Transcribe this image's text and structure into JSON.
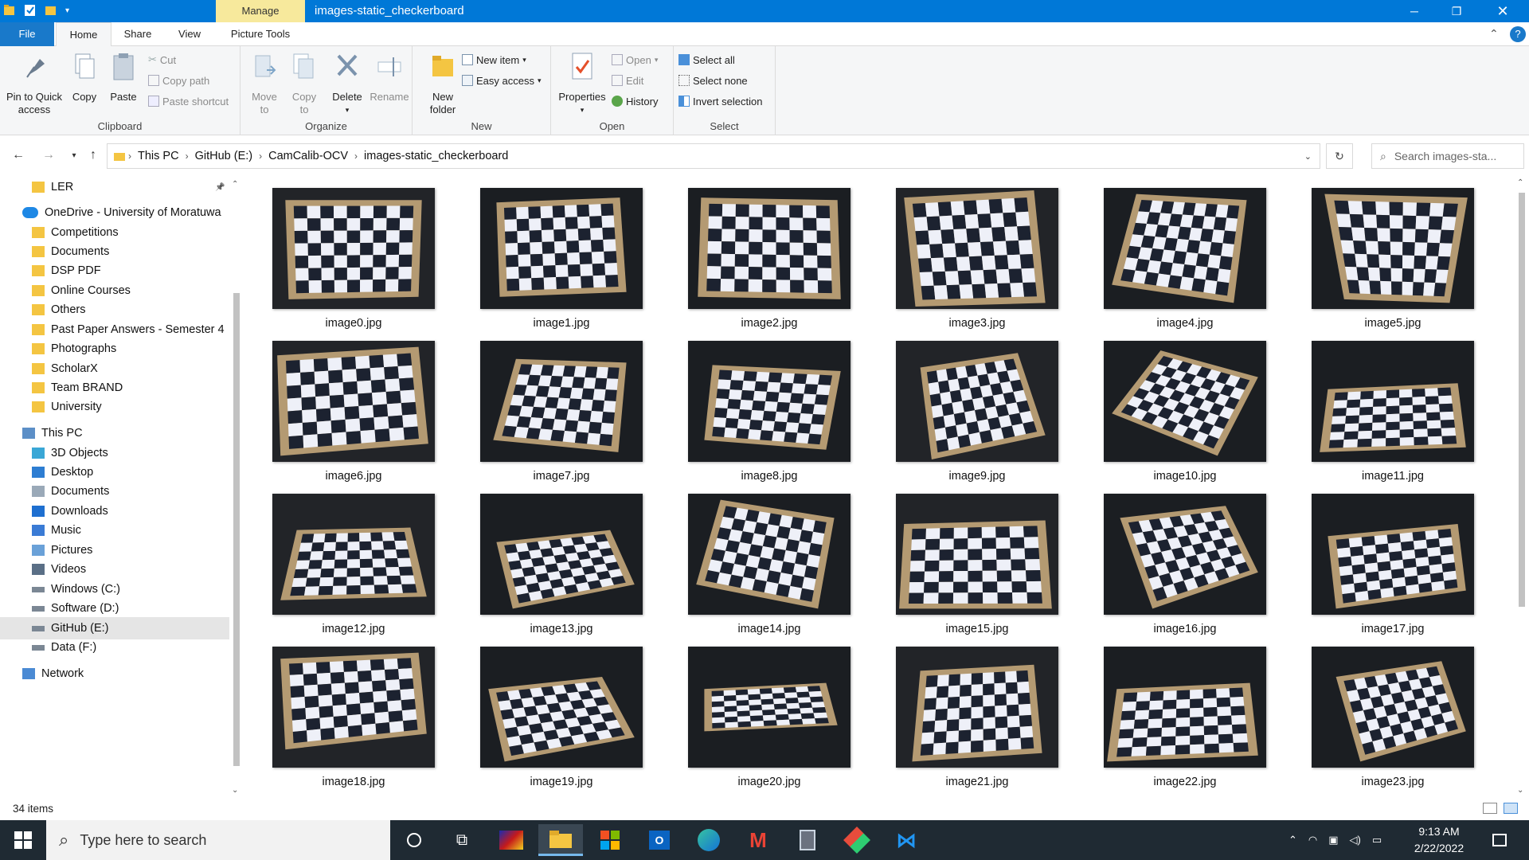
{
  "window": {
    "title": "images-static_checkerboard",
    "context_tab": "Manage"
  },
  "ribbon_tabs": [
    "File",
    "Home",
    "Share",
    "View",
    "Picture Tools"
  ],
  "ribbon": {
    "clipboard": {
      "label": "Clipboard",
      "pin": "Pin to Quick access",
      "copy": "Copy",
      "paste": "Paste",
      "cut": "Cut",
      "copy_path": "Copy path",
      "paste_shortcut": "Paste shortcut"
    },
    "organize": {
      "label": "Organize",
      "move_to": "Move to",
      "copy_to": "Copy to",
      "delete": "Delete",
      "rename": "Rename"
    },
    "new": {
      "label": "New",
      "new_folder": "New folder",
      "new_item": "New item",
      "easy_access": "Easy access"
    },
    "open": {
      "label": "Open",
      "properties": "Properties",
      "open": "Open",
      "edit": "Edit",
      "history": "History"
    },
    "select": {
      "label": "Select",
      "select_all": "Select all",
      "select_none": "Select none",
      "invert": "Invert selection"
    }
  },
  "address": {
    "crumbs": [
      "This PC",
      "GitHub (E:)",
      "CamCalib-OCV",
      "images-static_checkerboard"
    ],
    "search_placeholder": "Search images-sta..."
  },
  "nav": {
    "items": [
      {
        "label": "LER",
        "icon": "folder-icon"
      },
      {
        "label": "OneDrive - University of Moratuwa",
        "icon": "cloud-icon"
      },
      {
        "label": "Competitions",
        "icon": "folder-icon"
      },
      {
        "label": "Documents",
        "icon": "folder-icon"
      },
      {
        "label": "DSP PDF",
        "icon": "folder-icon"
      },
      {
        "label": "Online Courses",
        "icon": "folder-icon"
      },
      {
        "label": "Others",
        "icon": "folder-icon"
      },
      {
        "label": "Past Paper Answers -  Semester 4",
        "icon": "folder-icon"
      },
      {
        "label": "Photographs",
        "icon": "folder-icon"
      },
      {
        "label": "ScholarX",
        "icon": "folder-icon"
      },
      {
        "label": "Team BRAND",
        "icon": "folder-icon"
      },
      {
        "label": "University",
        "icon": "folder-icon"
      },
      {
        "label": "This PC",
        "icon": "computer-icon"
      },
      {
        "label": "3D Objects",
        "icon": "cube-icon"
      },
      {
        "label": "Desktop",
        "icon": "desktop-icon"
      },
      {
        "label": "Documents",
        "icon": "document-icon"
      },
      {
        "label": "Downloads",
        "icon": "download-icon"
      },
      {
        "label": "Music",
        "icon": "music-icon"
      },
      {
        "label": "Pictures",
        "icon": "picture-icon"
      },
      {
        "label": "Videos",
        "icon": "video-icon"
      },
      {
        "label": "Windows (C:)",
        "icon": "drive-icon"
      },
      {
        "label": "Software (D:)",
        "icon": "drive-icon"
      },
      {
        "label": "GitHub (E:)",
        "icon": "drive-icon"
      },
      {
        "label": "Data (F:)",
        "icon": "drive-icon"
      },
      {
        "label": "Network",
        "icon": "network-icon"
      }
    ]
  },
  "files": [
    "image0.jpg",
    "image1.jpg",
    "image2.jpg",
    "image3.jpg",
    "image4.jpg",
    "image5.jpg",
    "image6.jpg",
    "image7.jpg",
    "image8.jpg",
    "image9.jpg",
    "image10.jpg",
    "image11.jpg",
    "image12.jpg",
    "image13.jpg",
    "image14.jpg",
    "image15.jpg",
    "image16.jpg",
    "image17.jpg",
    "image18.jpg",
    "image19.jpg",
    "image20.jpg",
    "image21.jpg",
    "image22.jpg",
    "image23.jpg"
  ],
  "status": {
    "item_count": "34 items"
  },
  "taskbar": {
    "search_placeholder": "Type here to search",
    "time": "9:13 AM",
    "date": "2/22/2022"
  },
  "colors": {
    "accent": "#0078d7",
    "manage_tab": "#f7e99c",
    "taskbar": "#1f2a33",
    "folder": "#f4c542"
  }
}
